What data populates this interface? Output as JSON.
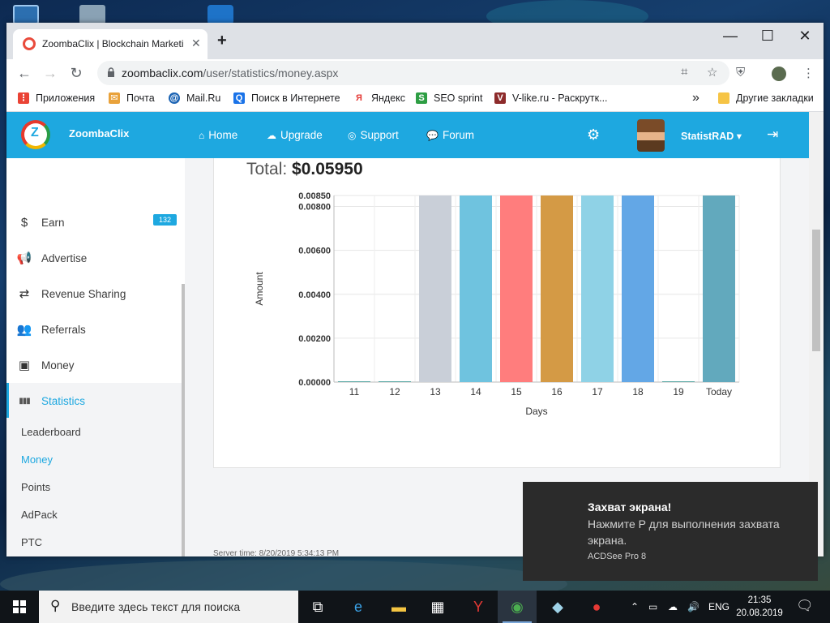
{
  "browser": {
    "tab_title": "ZoombaClix | Blockchain Marketi",
    "new_tab_symbol": "+",
    "url_host": "zoombaclix.com",
    "url_path": "/user/statistics/money.aspx",
    "controls": {
      "minimize": "—",
      "maximize": "☐",
      "close": "✕"
    },
    "bookmarks": [
      {
        "label": "Приложения",
        "icon": "apps-grid-icon",
        "color": "#ea4335"
      },
      {
        "label": "Почта",
        "icon": "mail-icon",
        "color": "#e9a23b"
      },
      {
        "label": "Mail.Ru",
        "icon": "at-icon",
        "color": "#1c64b4"
      },
      {
        "label": "Поиск в Интернете",
        "icon": "search-icon",
        "color": "#1a73e8"
      },
      {
        "label": "Яндекс",
        "icon": "yandex-icon",
        "color": "#e53935"
      },
      {
        "label": "SEO sprint",
        "icon": "seosprint-icon",
        "color": "#2e9e44"
      },
      {
        "label": "V-like.ru - Раскрутк...",
        "icon": "vlike-icon",
        "color": "#8d2b2b"
      }
    ],
    "overflow_symbol": "»",
    "other_bookmarks": "Другие закладки"
  },
  "site": {
    "brand": "ZoombaClix",
    "logo_letter": "Z",
    "nav": [
      {
        "label": "Home",
        "icon": "⌂"
      },
      {
        "label": "Upgrade",
        "icon": "☁"
      },
      {
        "label": "Support",
        "icon": "◎"
      },
      {
        "label": "Forum",
        "icon": "💬"
      }
    ],
    "username": "StatistRAD ▾",
    "settings_icon": "⚙",
    "logout_icon": "⇥"
  },
  "sidebar": {
    "items": [
      {
        "label": "Earn",
        "icon": "$",
        "badge": "132"
      },
      {
        "label": "Advertise",
        "icon": "📢"
      },
      {
        "label": "Revenue Sharing",
        "icon": "⇄"
      },
      {
        "label": "Referrals",
        "icon": "👥"
      },
      {
        "label": "Money",
        "icon": "▣"
      },
      {
        "label": "Statistics",
        "icon": "▮▮▮",
        "active": true
      }
    ],
    "sub_items": [
      {
        "label": "Leaderboard"
      },
      {
        "label": "Money",
        "active": true
      },
      {
        "label": "Points"
      },
      {
        "label": "AdPack"
      },
      {
        "label": "PTC"
      }
    ]
  },
  "stats": {
    "total_label": "Total:",
    "total_value": "$0.05950",
    "server_time": "Server time: 8/20/2019 5:34:13 PM"
  },
  "chart_data": {
    "type": "bar",
    "categories": [
      "11",
      "12",
      "13",
      "14",
      "15",
      "16",
      "17",
      "18",
      "19",
      "Today"
    ],
    "values": [
      0,
      0,
      0.0085,
      0.0085,
      0.0085,
      0.0085,
      0.0085,
      0.0085,
      0,
      0.0085
    ],
    "colors": [
      "#5ba9a6",
      "#5ba9a6",
      "#c9cfd8",
      "#6fc3df",
      "#ff7d7d",
      "#d49a45",
      "#8fd2e6",
      "#63a7e6",
      "#5ba9a6",
      "#62a9bd"
    ],
    "xlabel": "Days",
    "ylabel": "Amount",
    "ylim": [
      0,
      0.0085
    ],
    "yticks": [
      "0.00000",
      "0.00200",
      "0.00400",
      "0.00600",
      "0.00800",
      "0.00850"
    ],
    "ytick_values": [
      0,
      0.002,
      0.004,
      0.006,
      0.008,
      0.0085
    ],
    "grid": true
  },
  "toast": {
    "title": "Захват экрана!",
    "body": "Нажмите P для выполнения захвата экрана.",
    "app": "ACDSee Pro 8"
  },
  "taskbar": {
    "search_placeholder": "Введите здесь текст для поиска",
    "language": "ENG",
    "time": "21:35",
    "date": "20.08.2019"
  }
}
